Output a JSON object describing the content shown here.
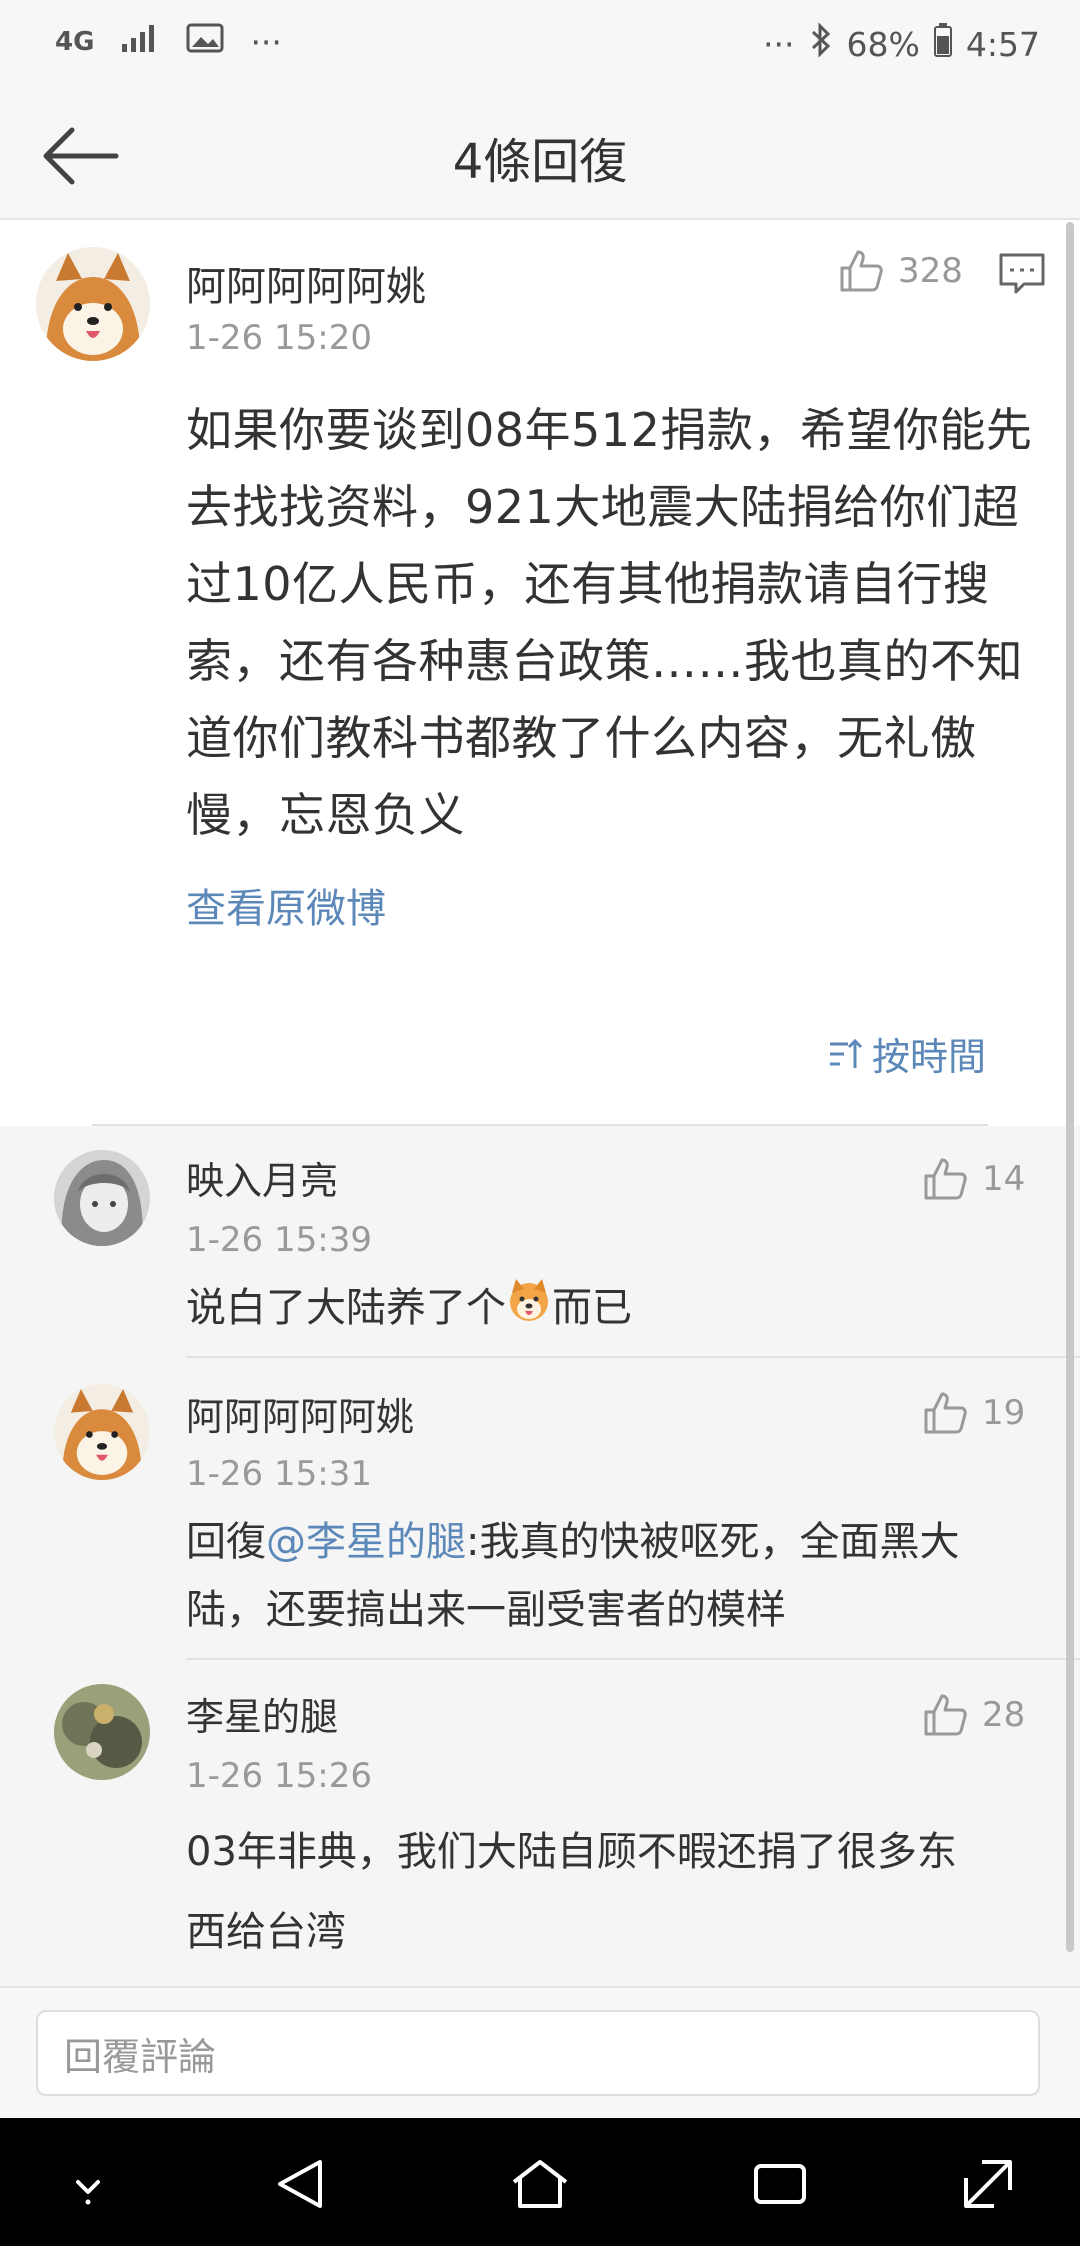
{
  "status_bar": {
    "network": "4G",
    "more_left": "···",
    "more_right": "···",
    "battery": "68%",
    "time": "4:57"
  },
  "nav": {
    "title": "4條回復"
  },
  "main_comment": {
    "author": "阿阿阿阿阿姚",
    "time": "1-26 15:20",
    "likes": "328",
    "lines": [
      "如果你要谈到08年512捐款，希望你能先",
      "去找找资料，921大地震大陆捐给你们超",
      "过10亿人民币，还有其他捐款请自行搜",
      "索，还有各种惠台政策……我也真的不知",
      "道你们教科书都教了什么内容，无礼傲",
      "慢，忘恩负义"
    ],
    "view_original": "查看原微博",
    "sort_label": "按時間"
  },
  "replies": [
    {
      "author": "映入月亮",
      "time": "1-26 15:39",
      "likes": "14",
      "text_before": "说白了大陆养了个",
      "text_after": "而已"
    },
    {
      "author": "阿阿阿阿阿姚",
      "time": "1-26 15:31",
      "likes": "19",
      "prefix": "回復",
      "mention": "@李星的腿",
      "line1_rest": ":我真的快被呕死，全面黑大",
      "line2": "陆，还要搞出来一副受害者的模样"
    },
    {
      "author": "李星的腿",
      "time": "1-26 15:26",
      "likes": "28",
      "line1": "03年非典，我们大陆自顾不暇还捐了很多东",
      "line2": "西给台湾"
    }
  ],
  "compose": {
    "placeholder": "回覆評論"
  }
}
